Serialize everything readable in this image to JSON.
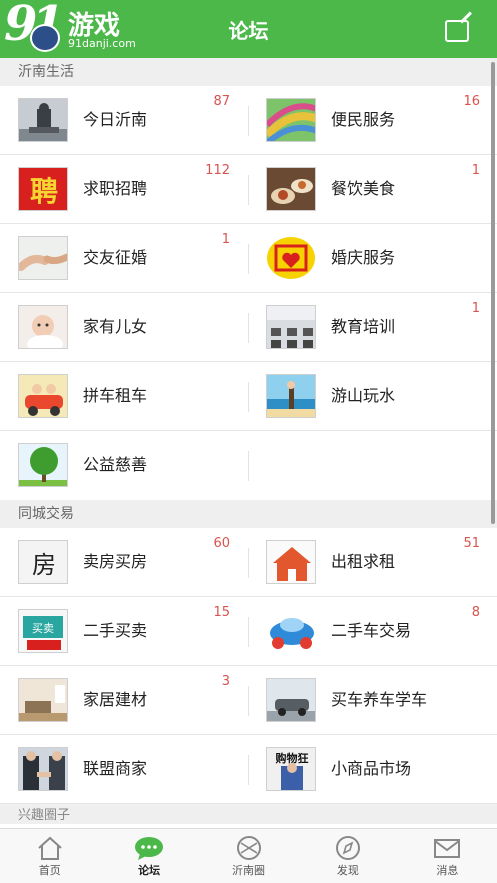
{
  "header": {
    "logo_number": "91",
    "logo_text": "游戏",
    "logo_domain": "91danji.com",
    "title": "论坛",
    "compose_icon": "compose-icon"
  },
  "sections": [
    {
      "title": "沂南生活",
      "items": [
        {
          "label": "今日沂南",
          "badge": "87",
          "icon": "statue-photo"
        },
        {
          "label": "便民服务",
          "badge": "16",
          "icon": "colorful-road-photo"
        },
        {
          "label": "求职招聘",
          "badge": "112",
          "icon": "recruit-character"
        },
        {
          "label": "餐饮美食",
          "badge": "1",
          "icon": "food-photo"
        },
        {
          "label": "交友征婚",
          "badge": "1",
          "icon": "hands-photo"
        },
        {
          "label": "婚庆服务",
          "badge": "",
          "icon": "double-happiness-icon"
        },
        {
          "label": "家有儿女",
          "badge": "",
          "icon": "baby-photo"
        },
        {
          "label": "教育培训",
          "badge": "1",
          "icon": "classroom-photo"
        },
        {
          "label": "拼车租车",
          "badge": "",
          "icon": "carpool-cartoon"
        },
        {
          "label": "游山玩水",
          "badge": "",
          "icon": "beach-photo"
        },
        {
          "label": "公益慈善",
          "badge": "",
          "icon": "tree-photo"
        }
      ]
    },
    {
      "title": "同城交易",
      "items": [
        {
          "label": "卖房买房",
          "badge": "60",
          "icon": "house-calligraphy"
        },
        {
          "label": "出租求租",
          "badge": "51",
          "icon": "house-icon"
        },
        {
          "label": "二手买卖",
          "badge": "15",
          "icon": "secondhand-sign"
        },
        {
          "label": "二手车交易",
          "badge": "8",
          "icon": "cartoon-car"
        },
        {
          "label": "家居建材",
          "badge": "3",
          "icon": "living-room-photo"
        },
        {
          "label": "买车养车学车",
          "badge": "",
          "icon": "suv-photo"
        },
        {
          "label": "联盟商家",
          "badge": "",
          "icon": "handshake-photo"
        },
        {
          "label": "小商品市场",
          "badge": "",
          "icon": "shopping-poster"
        }
      ]
    }
  ],
  "next_section_peek": "兴趣圈子",
  "tabs": [
    {
      "label": "首页",
      "icon": "home-icon",
      "active": false
    },
    {
      "label": "论坛",
      "icon": "chat-bubble-icon",
      "active": true
    },
    {
      "label": "沂南圈",
      "icon": "circle-icon",
      "active": false
    },
    {
      "label": "发现",
      "icon": "compass-icon",
      "active": false
    },
    {
      "label": "消息",
      "icon": "mail-icon",
      "active": false
    }
  ],
  "colors": {
    "brand_green": "#4cb849",
    "badge_red": "#d9534f",
    "section_bg": "#efefef"
  }
}
